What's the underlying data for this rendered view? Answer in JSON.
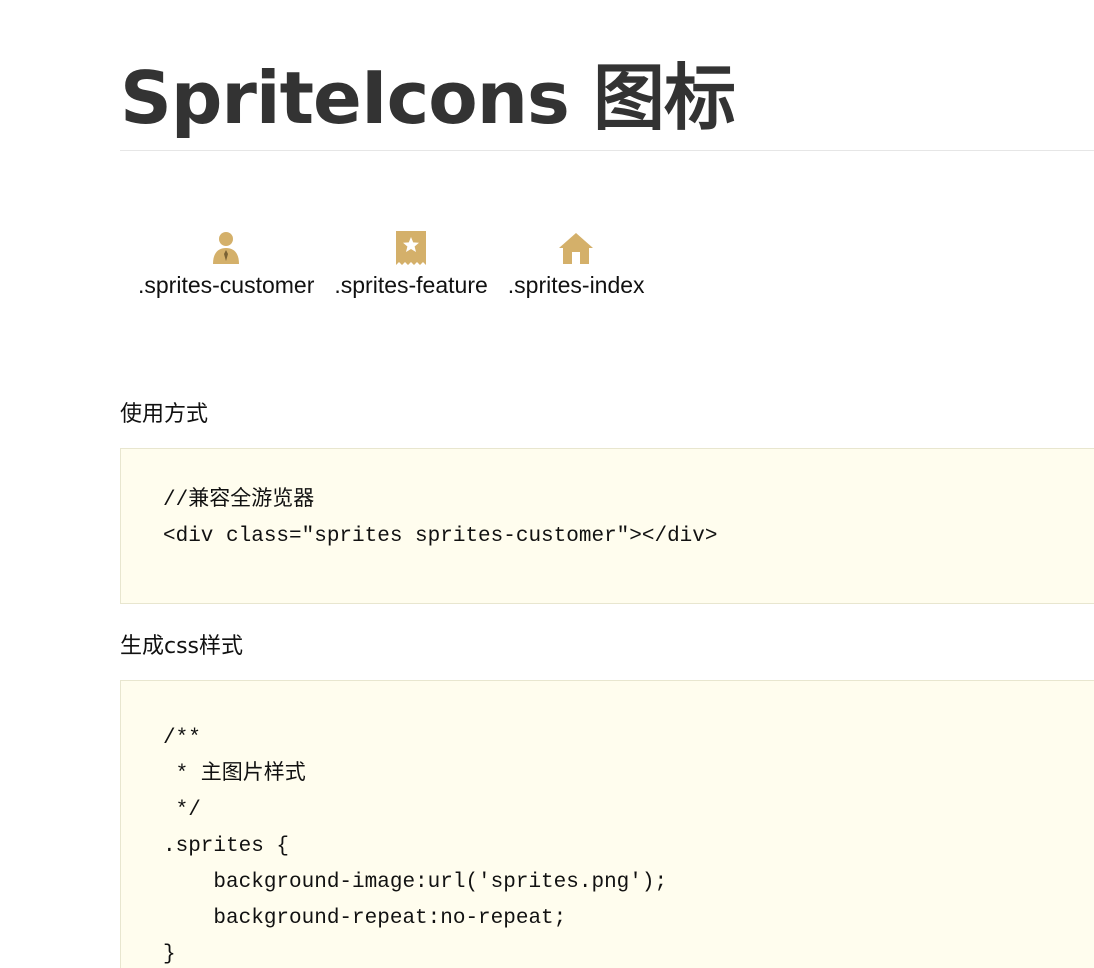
{
  "title": "SpriteIcons 图标",
  "icons": [
    {
      "icon": "user-icon",
      "label": ".sprites-customer"
    },
    {
      "icon": "bookmark-star-icon",
      "label": ".sprites-feature"
    },
    {
      "icon": "home-icon",
      "label": ".sprites-index"
    }
  ],
  "colors": {
    "icon_gold": "#d4b06a",
    "code_bg": "#fffdee",
    "code_border": "#e8e6cf",
    "title": "#333333"
  },
  "usage": {
    "label": "使用方式",
    "code": [
      "//兼容全游览器",
      "<div class=\"sprites sprites-customer\"></div>"
    ]
  },
  "generated_css": {
    "label": "生成css样式",
    "code": [
      "/**",
      " * 主图片样式",
      " */",
      ".sprites {",
      "    background-image:url('sprites.png');",
      "    background-repeat:no-repeat;",
      "}"
    ]
  }
}
